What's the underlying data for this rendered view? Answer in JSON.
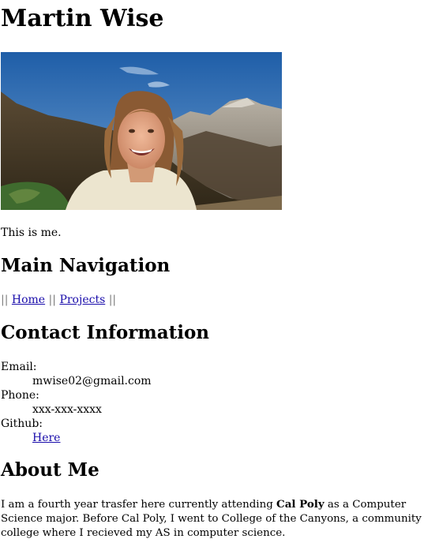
{
  "header": {
    "title": "Martin Wise"
  },
  "photo": {
    "alt": "Photo of Martin Wise",
    "caption": "This is me."
  },
  "navigation": {
    "heading": "Main Navigation",
    "separator_start": "||",
    "separator_middle": "||",
    "separator_end": "||",
    "links": [
      {
        "label": "Home"
      },
      {
        "label": "Projects"
      }
    ]
  },
  "contact": {
    "heading": "Contact Information",
    "items": [
      {
        "term": "Email:",
        "value": "mwise02@gmail.com"
      },
      {
        "term": "Phone:",
        "value": "xxx-xxx-xxxx"
      },
      {
        "term": "Github:",
        "value": "Here"
      }
    ]
  },
  "about": {
    "heading": "About Me",
    "text_before": "I am a fourth year trasfer here currently attending ",
    "school": "Cal Poly",
    "text_after": " as a Computer Science major. Before Cal Poly, I went to College of the Canyons, a community college where I recieved my AS in computer science."
  },
  "colors": {
    "link": "#1a0dab",
    "separator": "#7a7a7a",
    "sky": "#2f6fb5"
  }
}
